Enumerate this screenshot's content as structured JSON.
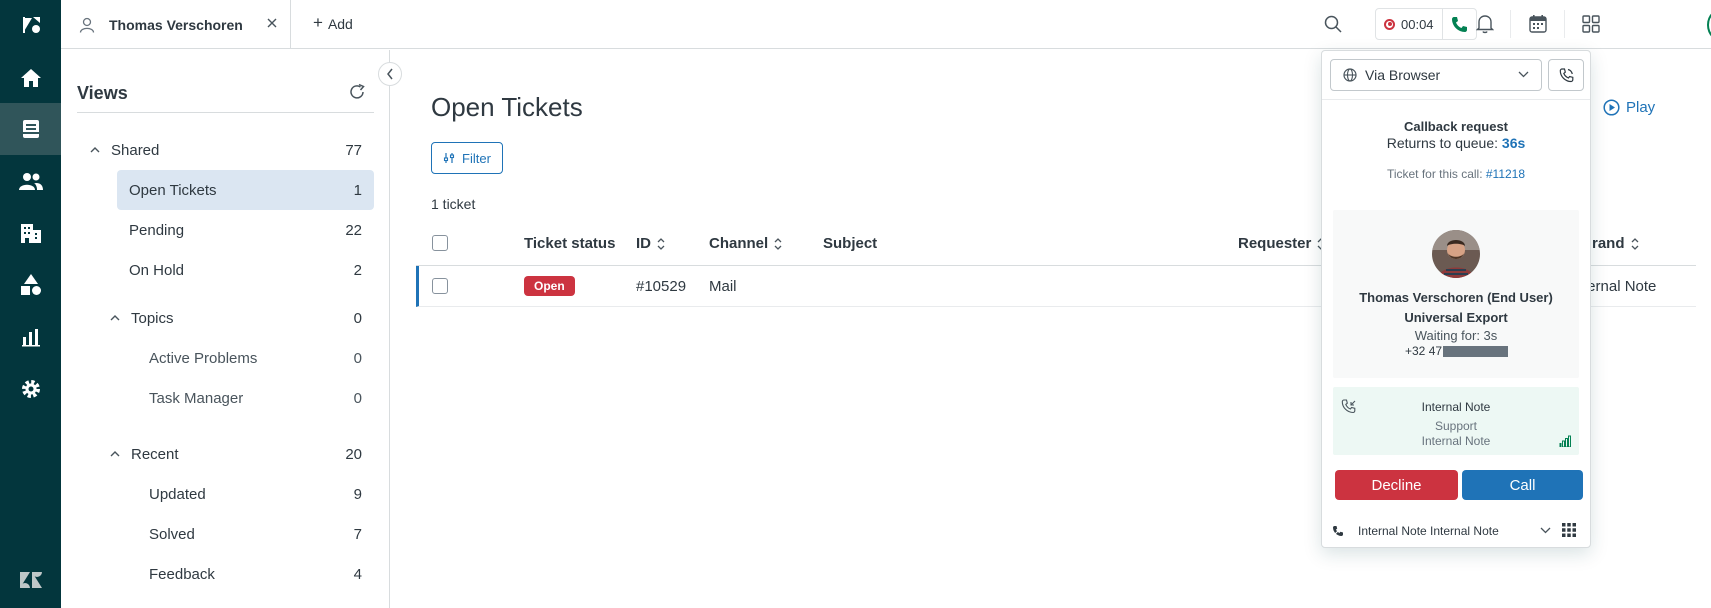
{
  "topbar": {
    "tab_title": "Thomas Verschoren",
    "add_label": "Add",
    "timer": "00:04"
  },
  "views": {
    "title": "Views",
    "groups": [
      {
        "label": "Shared",
        "count": "77"
      },
      {
        "label": "Topics",
        "count": "0"
      },
      {
        "label": "Recent",
        "count": "20"
      }
    ],
    "shared_items": [
      {
        "label": "Open Tickets",
        "count": "1"
      },
      {
        "label": "Pending",
        "count": "22"
      },
      {
        "label": "On Hold",
        "count": "2"
      }
    ],
    "topic_items": [
      {
        "label": "Active Problems",
        "count": "0"
      },
      {
        "label": "Task Manager",
        "count": "0"
      }
    ],
    "recent_items": [
      {
        "label": "Updated",
        "count": "9"
      },
      {
        "label": "Solved",
        "count": "7"
      },
      {
        "label": "Feedback",
        "count": "4"
      }
    ]
  },
  "main": {
    "title": "Open Tickets",
    "filter_label": "Filter",
    "play_label": "Play",
    "ticket_count": "1 ticket",
    "columns": [
      "Ticket status",
      "ID",
      "Channel",
      "Subject",
      "Requester",
      "rand"
    ],
    "rows": [
      {
        "status": "Open",
        "id": "#10529",
        "channel": "Mail",
        "subject": "",
        "requester": "",
        "brand": "ternal Note"
      }
    ]
  },
  "call_panel": {
    "via": "Via Browser",
    "callback_title": "Callback request",
    "queue_label": "Returns to queue: ",
    "queue_secs": "36s",
    "ticket_label": "Ticket for this call: ",
    "ticket_link": "#11218",
    "caller_name": "Thomas Verschoren (End User)",
    "caller_org": "Universal Export",
    "waiting": "Waiting for: 3s",
    "phone_prefix": "+32 47",
    "line_name": "Internal Note",
    "line_group": "Support",
    "line_sub": "Internal Note",
    "decline_label": "Decline",
    "call_label": "Call",
    "footer_line": "Internal Note Internal Note"
  },
  "colors": {
    "rail": "#03363d",
    "accent": "#1f73b7",
    "danger": "#cc3340",
    "success": "#038153"
  }
}
